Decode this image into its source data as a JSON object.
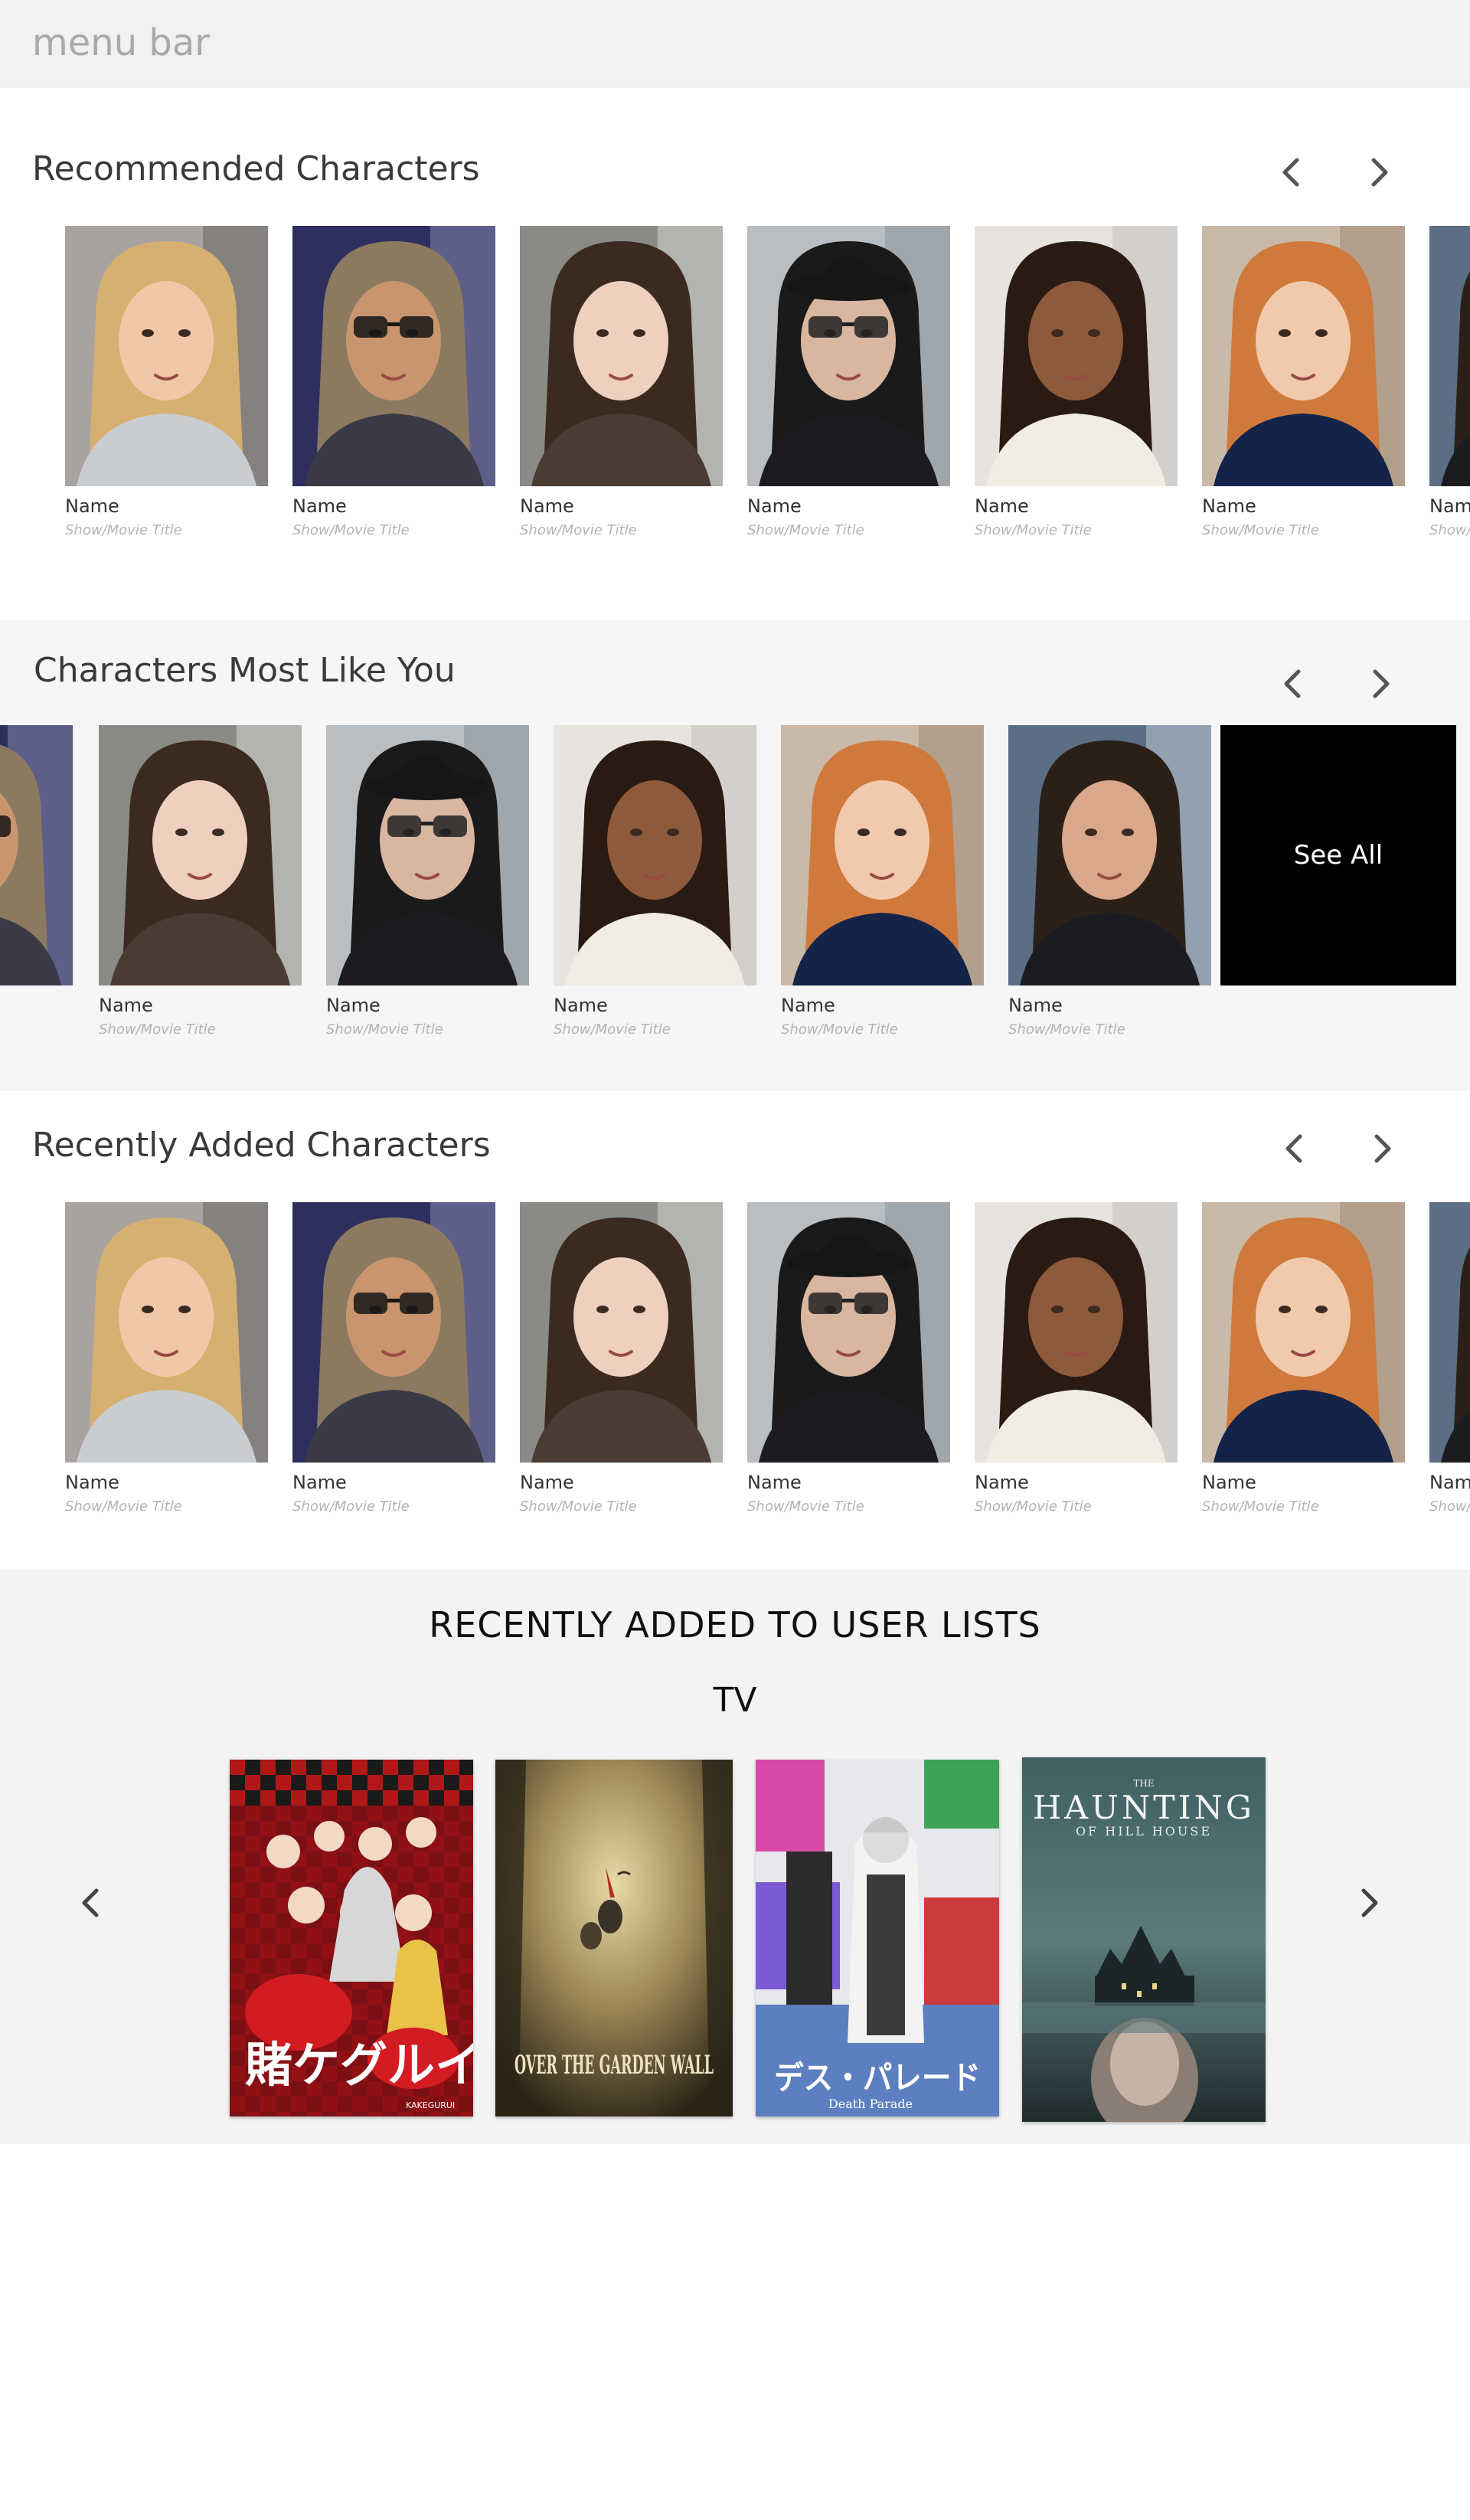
{
  "menu_bar": {
    "label": "menu bar"
  },
  "sections": {
    "recommended": {
      "title": "Recommended Characters"
    },
    "most_like_you": {
      "title": "Characters Most Like You",
      "see_all": "See All"
    },
    "recently_added": {
      "title": "Recently Added Characters"
    }
  },
  "card": {
    "name": "Name",
    "subtitle": "Show/Movie Title"
  },
  "cards": {
    "recommended": [
      {
        "name": "Name",
        "subtitle": "Show/Movie Title"
      },
      {
        "name": "Name",
        "subtitle": "Show/Movie Title"
      },
      {
        "name": "Name",
        "subtitle": "Show/Movie Title"
      },
      {
        "name": "Name",
        "subtitle": "Show/Movie Title"
      },
      {
        "name": "Name",
        "subtitle": "Show/Movie Title"
      },
      {
        "name": "Name",
        "subtitle": "Show/Movie Title"
      },
      {
        "name": "Name",
        "subtitle": "Show/Movie Title"
      }
    ],
    "most_like_you": [
      {
        "name": "Name",
        "subtitle": "Show/Movie Title"
      },
      {
        "name": "Name",
        "subtitle": "Show/Movie Title"
      },
      {
        "name": "Name",
        "subtitle": "Show/Movie Title"
      },
      {
        "name": "Name",
        "subtitle": "Show/Movie Title"
      },
      {
        "name": "Name",
        "subtitle": "Show/Movie Title"
      }
    ],
    "recently_added": [
      {
        "name": "Name",
        "subtitle": "Show/Movie Title"
      },
      {
        "name": "Name",
        "subtitle": "Show/Movie Title"
      },
      {
        "name": "Name",
        "subtitle": "Show/Movie Title"
      },
      {
        "name": "Name",
        "subtitle": "Show/Movie Title"
      },
      {
        "name": "Name",
        "subtitle": "Show/Movie Title"
      },
      {
        "name": "Name",
        "subtitle": "Show/Movie Title"
      },
      {
        "name": "Name",
        "subtitle": "Show/Movie Title"
      }
    ]
  },
  "user_lists": {
    "title": "RECENTLY ADDED TO USER LISTS",
    "category": "TV",
    "posters": [
      {
        "title_text": "賭ケグルイ",
        "small_text": "KAKEGURUI"
      },
      {
        "title_text": "OVER THE GARDEN WALL"
      },
      {
        "title_text": "デス・パレード",
        "small_text": "Death Parade"
      },
      {
        "title_text": "HAUNTING",
        "top_text": "THE",
        "small_text": "OF HILL HOUSE"
      }
    ]
  },
  "icons": {
    "prev": "chevron-left-icon",
    "next": "chevron-right-icon"
  }
}
